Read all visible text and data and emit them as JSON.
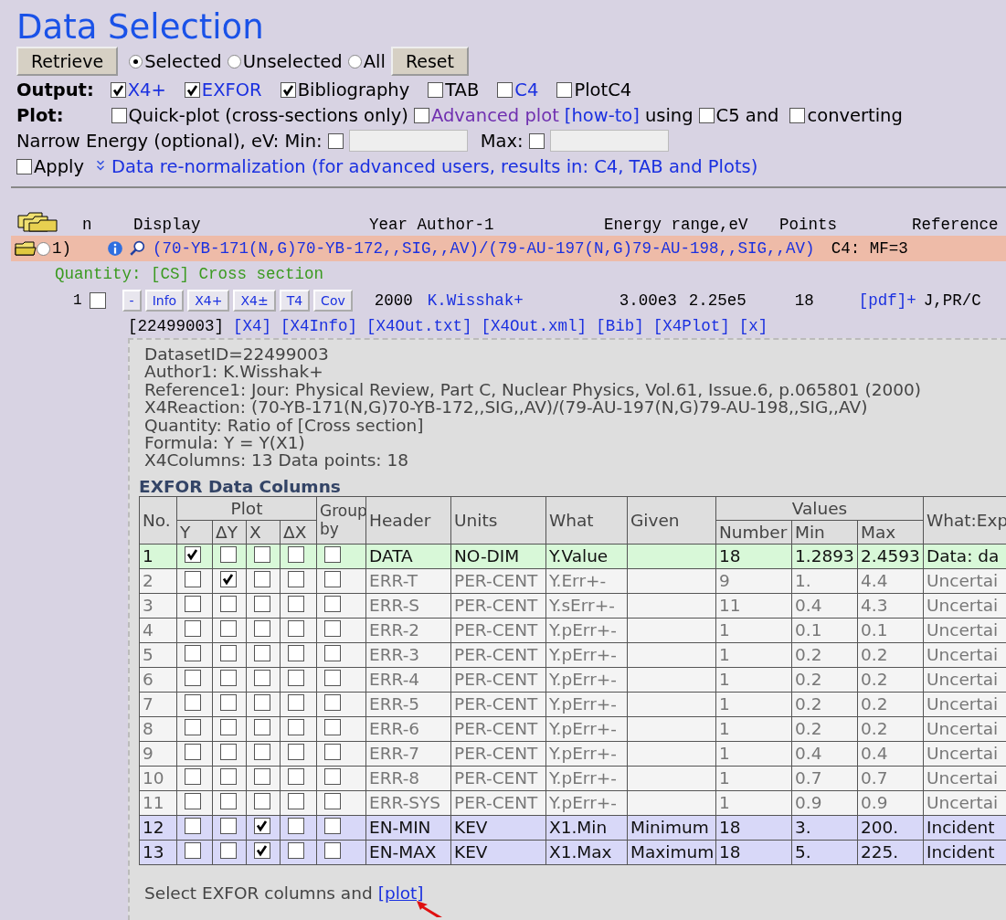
{
  "title": "Data Selection",
  "controls": {
    "retrieve": "Retrieve",
    "reset": "Reset",
    "radios": [
      {
        "label": "Selected",
        "selected": true
      },
      {
        "label": "Unselected",
        "selected": false
      },
      {
        "label": "All",
        "selected": false
      }
    ]
  },
  "output": {
    "label": "Output:",
    "options": [
      {
        "label": "X4+",
        "checked": true,
        "kind": "link"
      },
      {
        "label": "EXFOR",
        "checked": true,
        "kind": "link"
      },
      {
        "label": "Bibliography",
        "checked": true,
        "kind": "plain"
      },
      {
        "label": "TAB",
        "checked": false,
        "kind": "plain"
      },
      {
        "label": "C4",
        "checked": false,
        "kind": "link"
      },
      {
        "label": "PlotC4",
        "checked": false,
        "kind": "plain"
      }
    ]
  },
  "plot": {
    "label": "Plot:",
    "quick": {
      "label": "Quick-plot (cross-sections only)",
      "checked": false
    },
    "advanced": {
      "label": "Advanced plot",
      "checked": false
    },
    "howto": "[how-to]",
    "using": "using",
    "c5": {
      "label": "C5 and",
      "checked": false
    },
    "converting": {
      "label": "converting",
      "checked": false
    }
  },
  "energy": {
    "label": "Narrow Energy (optional), eV: Min:",
    "min_checked": false,
    "max_label": "Max:",
    "max_checked": false
  },
  "apply": {
    "label": "Apply",
    "checked": false
  },
  "renorm": "Data re-normalization (for advanced users, results in: C4, TAB and Plots)",
  "list_header": [
    "n",
    "Display",
    "Year Author-1",
    "Energy range,eV",
    "Points",
    "Reference"
  ],
  "entry": {
    "n": "1)",
    "selected": false,
    "reaction": "(70-YB-171(N,G)70-YB-172,,SIG,,AV)/(79-AU-197(N,G)79-AU-198,,SIG,,AV)",
    "reference": "C4: MF=3"
  },
  "quantity": "Quantity: [CS] Cross section",
  "dataset": {
    "n": "1",
    "checked": false,
    "buttons": [
      "-",
      "Info",
      "X4+",
      "X4±",
      "T4",
      "Cov"
    ],
    "year": "2000",
    "author": "K.Wisshak+",
    "emin": "3.00e3",
    "emax": "2.25e5",
    "points": "18",
    "ref_link": "[pdf]+",
    "ref": "J,PR/C",
    "id": "[22499003]",
    "links": [
      "[X4]",
      "[X4Info]",
      "[X4Out.txt]",
      "[X4Out.xml]",
      "[Bib]",
      "[X4Plot]",
      "[x]"
    ]
  },
  "info_lines": [
    "DatasetID=22499003",
    "Author1: K.Wisshak+",
    "Reference1: Jour: Physical Review, Part C, Nuclear Physics, Vol.61, Issue.6, p.065801 (2000)",
    "X4Reaction: (70-YB-171(N,G)70-YB-172,,SIG,,AV)/(79-AU-197(N,G)79-AU-198,,SIG,,AV)",
    "Quantity: Ratio of [Cross section]",
    "Formula: Y = Y(X1)",
    "X4Columns: 13   Data points: 18"
  ],
  "table": {
    "title": "EXFOR Data Columns",
    "head": {
      "no": "No.",
      "plot": "Plot",
      "plot_cols": [
        "Y",
        "ΔY",
        "X",
        "ΔX"
      ],
      "group": "Group by",
      "header": "Header",
      "units": "Units",
      "what": "What",
      "given": "Given",
      "values": "Values",
      "value_cols": [
        "Number",
        "Min",
        "Max"
      ],
      "desc": "What:Exp"
    },
    "rows": [
      {
        "no": "1",
        "kind": "data",
        "checks": [
          true,
          false,
          false,
          false,
          false
        ],
        "header": "DATA",
        "units": "NO-DIM",
        "what": "Y.Value",
        "given": "",
        "number": "18",
        "min": "1.2893",
        "max": "2.4593",
        "desc": "Data: da"
      },
      {
        "no": "2",
        "kind": "error",
        "checks": [
          false,
          true,
          false,
          false,
          false
        ],
        "header": "ERR-T",
        "units": "PER-CENT",
        "what": "Y.Err+-",
        "given": "",
        "number": "9",
        "min": "1.",
        "max": "4.4",
        "desc": "Uncertai"
      },
      {
        "no": "3",
        "kind": "error",
        "checks": [
          false,
          false,
          false,
          false,
          false
        ],
        "header": "ERR-S",
        "units": "PER-CENT",
        "what": "Y.sErr+-",
        "given": "",
        "number": "11",
        "min": "0.4",
        "max": "4.3",
        "desc": "Uncertai"
      },
      {
        "no": "4",
        "kind": "error",
        "checks": [
          false,
          false,
          false,
          false,
          false
        ],
        "header": "ERR-2",
        "units": "PER-CENT",
        "what": "Y.pErr+-",
        "given": "",
        "number": "1",
        "min": "0.1",
        "max": "0.1",
        "desc": "Uncertai"
      },
      {
        "no": "5",
        "kind": "error",
        "checks": [
          false,
          false,
          false,
          false,
          false
        ],
        "header": "ERR-3",
        "units": "PER-CENT",
        "what": "Y.pErr+-",
        "given": "",
        "number": "1",
        "min": "0.2",
        "max": "0.2",
        "desc": "Uncertai"
      },
      {
        "no": "6",
        "kind": "error",
        "checks": [
          false,
          false,
          false,
          false,
          false
        ],
        "header": "ERR-4",
        "units": "PER-CENT",
        "what": "Y.pErr+-",
        "given": "",
        "number": "1",
        "min": "0.2",
        "max": "0.2",
        "desc": "Uncertai"
      },
      {
        "no": "7",
        "kind": "error",
        "checks": [
          false,
          false,
          false,
          false,
          false
        ],
        "header": "ERR-5",
        "units": "PER-CENT",
        "what": "Y.pErr+-",
        "given": "",
        "number": "1",
        "min": "0.2",
        "max": "0.2",
        "desc": "Uncertai"
      },
      {
        "no": "8",
        "kind": "error",
        "checks": [
          false,
          false,
          false,
          false,
          false
        ],
        "header": "ERR-6",
        "units": "PER-CENT",
        "what": "Y.pErr+-",
        "given": "",
        "number": "1",
        "min": "0.2",
        "max": "0.2",
        "desc": "Uncertai"
      },
      {
        "no": "9",
        "kind": "error",
        "checks": [
          false,
          false,
          false,
          false,
          false
        ],
        "header": "ERR-7",
        "units": "PER-CENT",
        "what": "Y.pErr+-",
        "given": "",
        "number": "1",
        "min": "0.4",
        "max": "0.4",
        "desc": "Uncertai"
      },
      {
        "no": "10",
        "kind": "error",
        "checks": [
          false,
          false,
          false,
          false,
          false
        ],
        "header": "ERR-8",
        "units": "PER-CENT",
        "what": "Y.pErr+-",
        "given": "",
        "number": "1",
        "min": "0.7",
        "max": "0.7",
        "desc": "Uncertai"
      },
      {
        "no": "11",
        "kind": "error",
        "checks": [
          false,
          false,
          false,
          false,
          false
        ],
        "header": "ERR-SYS",
        "units": "PER-CENT",
        "what": "Y.pErr+-",
        "given": "",
        "number": "1",
        "min": "0.9",
        "max": "0.9",
        "desc": "Uncertai"
      },
      {
        "no": "12",
        "kind": "independent",
        "checks": [
          false,
          false,
          true,
          false,
          false
        ],
        "header": "EN-MIN",
        "units": "KEV",
        "what": "X1.Min",
        "given": "Minimum",
        "number": "18",
        "min": "3.",
        "max": "200.",
        "desc": "Incident"
      },
      {
        "no": "13",
        "kind": "independent",
        "checks": [
          false,
          false,
          true,
          false,
          false
        ],
        "header": "EN-MAX",
        "units": "KEV",
        "what": "X1.Max",
        "given": "Maximum",
        "number": "18",
        "min": "5.",
        "max": "225.",
        "desc": "Incident"
      }
    ]
  },
  "footer": {
    "text": "Select EXFOR columns and",
    "link": "[plot]"
  }
}
